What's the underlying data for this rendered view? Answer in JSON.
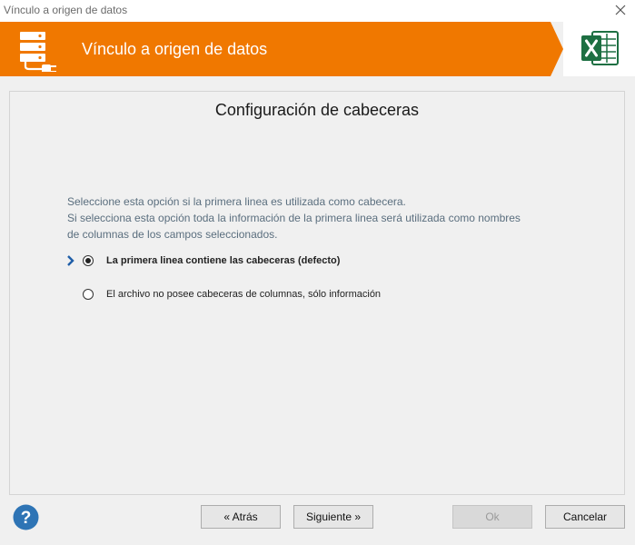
{
  "window": {
    "title": "Vínculo a origen de datos"
  },
  "banner": {
    "title": "Vínculo a origen de datos",
    "color": "#f07800",
    "icon": "database-plug-icon",
    "app_icon": "excel-icon"
  },
  "panel": {
    "title": "Configuración de cabeceras",
    "description": [
      "Seleccione esta opción si la primera linea es utilizada como cabecera.",
      "Si selecciona esta opción toda la información de la primera linea será utilizada como nombres",
      "de columnas de los campos seleccionados."
    ],
    "options": [
      {
        "label": "La primera linea contiene las cabeceras (defecto)",
        "selected": true
      },
      {
        "label": "El archivo no posee cabeceras de columnas, sólo información",
        "selected": false
      }
    ]
  },
  "buttons": {
    "back": "« Atrás",
    "next": "Siguiente »",
    "ok": "Ok",
    "cancel": "Cancelar"
  },
  "colors": {
    "accent": "#f07800",
    "help": "#2e74b5",
    "excel": "#1d6f42"
  }
}
